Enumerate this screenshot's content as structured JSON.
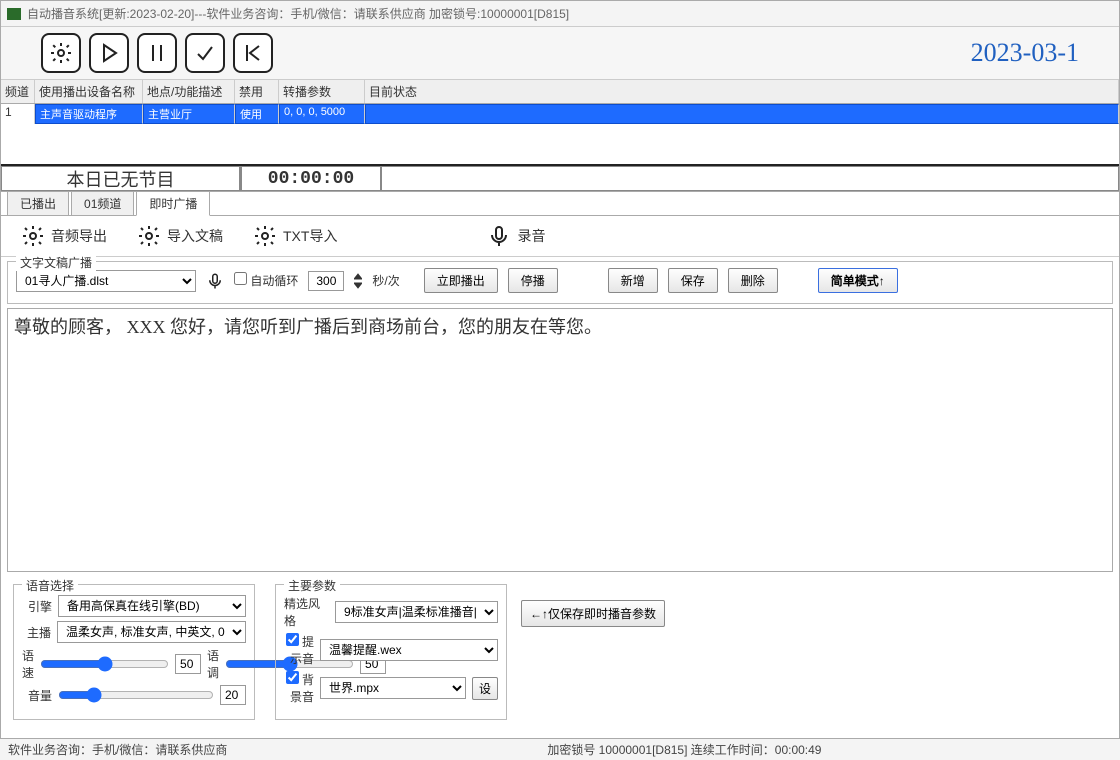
{
  "window_title": "自动播音系统[更新:2023-02-20]---软件业务咨询：手机/微信：请联系供应商  加密锁号:10000001[D815]",
  "top_date": "2023-03-1",
  "grid_headers": [
    "频道",
    "使用播出设备名称",
    "地点/功能描述",
    "禁用",
    "转播参数",
    "目前状态"
  ],
  "grid_row": {
    "ch": "1",
    "dev": "主声音驱动程序",
    "loc": "主营业厅",
    "dis": "使用",
    "par": "0, 0, 0, 5000",
    "sta": ""
  },
  "no_program": "本日已无节目",
  "timer": "00:00:00",
  "tabs": {
    "a": "已播出",
    "b": "01频道",
    "c": "即时广播"
  },
  "action": {
    "export": "音频导出",
    "script": "导入文稿",
    "txt": "TXT导入",
    "rec": "录音"
  },
  "fs_label": "文字文稿广播",
  "dropdown1": "01寻人广播.dlst",
  "auto_loop": "自动循环",
  "interval_val": "300",
  "interval_unit": "秒/次",
  "btns": {
    "play": "立即播出",
    "stop": "停播",
    "new": "新增",
    "save": "保存",
    "del": "删除",
    "simple": "简单模式↑"
  },
  "script_text": "尊敬的顾客，    XXX     您好，请您听到广播后到商场前台，您的朋友在等您。",
  "voice_legend": "语音选择",
  "param_legend": "主要参数",
  "voice": {
    "engine_lbl": "引擎",
    "engine_val": "备用高保真在线引擎(BD)",
    "anchor_lbl": "主播",
    "anchor_val": "温柔女声, 标准女声, 中英文, 0",
    "speed_lbl": "语速",
    "speed_val": "50",
    "pitch_lbl": "语调",
    "pitch_val": "50",
    "vol_lbl": "音量",
    "vol_val": "20"
  },
  "params": {
    "style_lbl": "精选风格",
    "style_val": "9标准女声|温柔标准播音|",
    "tip_lbl": "提示音",
    "tip_val": "温馨提醒.wex",
    "bg_lbl": "背景音",
    "bg_val": "世界.mpx",
    "set_btn": "设"
  },
  "save_only_btn": "←↑仅保存即时播音参数",
  "status": {
    "contact": "软件业务咨询：手机/微信：请联系供应商",
    "lock": "加密锁号  10000001[D815]  连续工作时间：",
    "uptime": "00:00:49"
  }
}
